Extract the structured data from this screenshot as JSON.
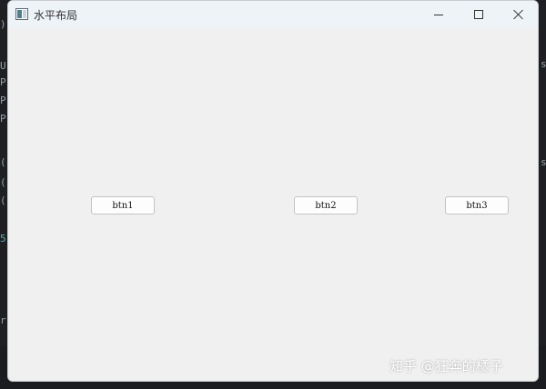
{
  "window": {
    "title": "水平布局",
    "controls": {
      "minimize_icon": "minimize-icon",
      "maximize_icon": "maximize-icon",
      "close_icon": "close-icon"
    }
  },
  "buttons": [
    {
      "label": "btn1"
    },
    {
      "label": "btn2"
    },
    {
      "label": "btn3"
    }
  ],
  "watermark": "知乎 @狂奔的橘子",
  "colors": {
    "window_bg": "#f0f0f0",
    "titlebar_bg": "#eef3f8",
    "button_bg": "#fdfdfd",
    "button_border": "#c4c4c4"
  }
}
